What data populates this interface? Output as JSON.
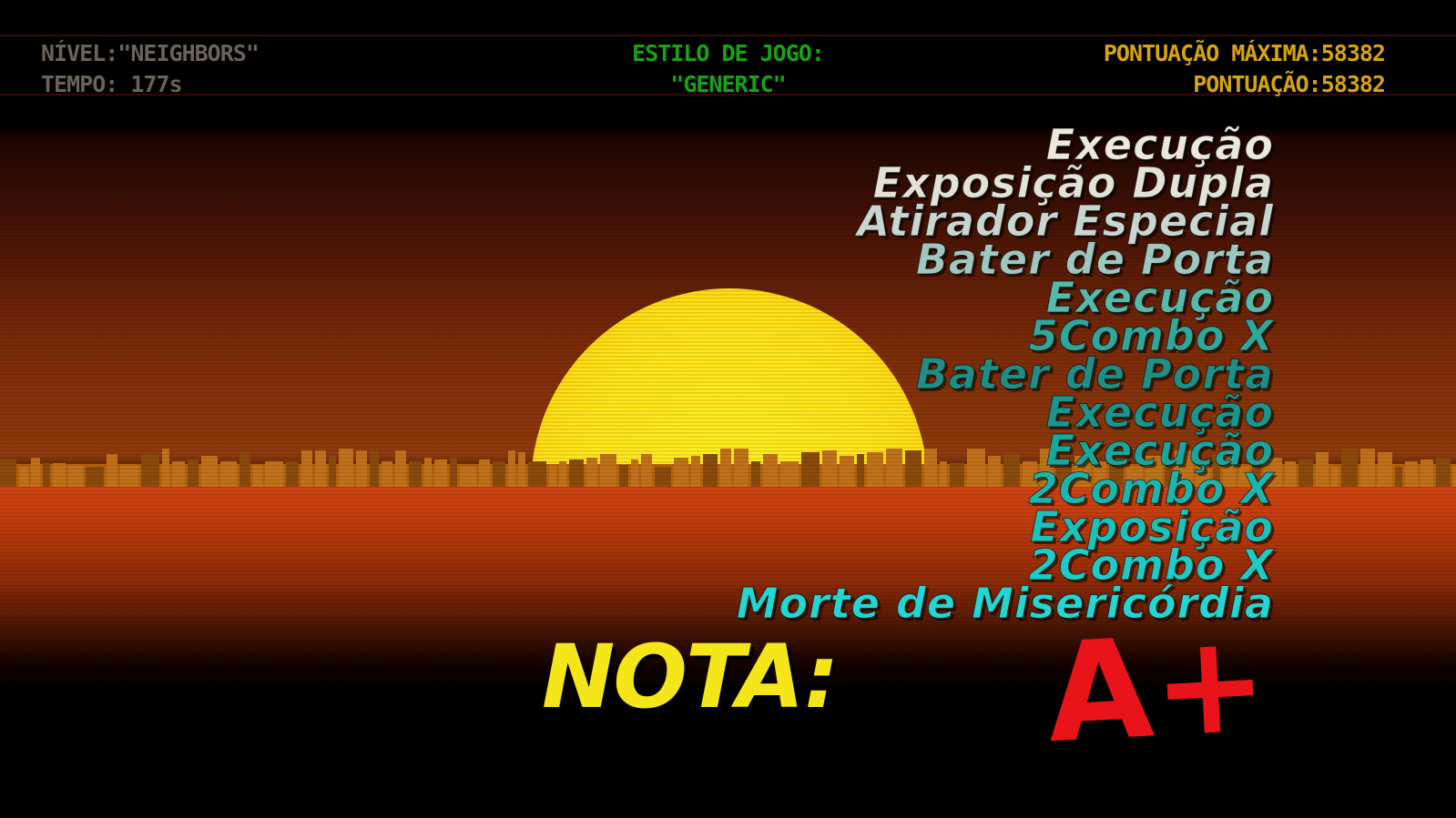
{
  "hud": {
    "level": "NÍVEL:\"NEIGHBORS\"",
    "time": "TEMPO: 177s",
    "style_label": "ESTILO DE JOGO:",
    "style_value": "\"GENERIC\"",
    "max_score": "PONTUAÇÃO MÁXIMA:58382",
    "score": "PONTUAÇÃO:58382",
    "colors": {
      "left": "#6b6259",
      "center": "#17a317",
      "right": "#d7a411"
    }
  },
  "combos": [
    {
      "label": "Execução",
      "color": "#ece8dc"
    },
    {
      "label": "Exposição Dupla",
      "color": "#e3e2d6"
    },
    {
      "label": "Atirador Especial",
      "color": "#c9d6cf"
    },
    {
      "label": "Bater de Porta",
      "color": "#9ec7bf"
    },
    {
      "label": "Execução",
      "color": "#55b9ac"
    },
    {
      "label": "5Combo X",
      "color": "#2fa79c"
    },
    {
      "label": "Bater de Porta",
      "color": "#1e8e86"
    },
    {
      "label": "Execução",
      "color": "#1a958e"
    },
    {
      "label": "Execução",
      "color": "#1aa69e"
    },
    {
      "label": "2Combo X",
      "color": "#19b5ae"
    },
    {
      "label": "Exposição",
      "color": "#1bc2bb"
    },
    {
      "label": "2Combo X",
      "color": "#1fcbc6"
    },
    {
      "label": "Morte de Misericórdia",
      "color": "#25d5d2"
    }
  ],
  "grade": {
    "label": "NOTA:",
    "value": "A+"
  }
}
